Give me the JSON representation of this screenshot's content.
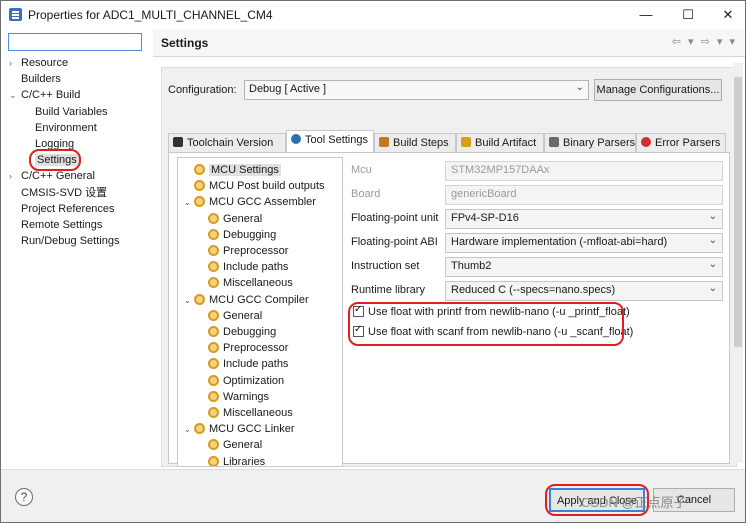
{
  "window": {
    "title": "Properties for ADC1_MULTI_CHANNEL_CM4",
    "minimize": "—",
    "maximize": "☐",
    "close": "✕"
  },
  "left_tree": {
    "filter_value": "",
    "items": [
      {
        "label": "Resource",
        "arrow": "›"
      },
      {
        "label": "Builders",
        "arrow": ""
      },
      {
        "label": "C/C++ Build",
        "arrow": "⌄"
      },
      {
        "label": "Build Variables",
        "arrow": ""
      },
      {
        "label": "Environment",
        "arrow": ""
      },
      {
        "label": "Logging",
        "arrow": ""
      },
      {
        "label": "Settings",
        "arrow": ""
      },
      {
        "label": "C/C++ General",
        "arrow": "›"
      },
      {
        "label": "CMSIS-SVD 设置",
        "arrow": ""
      },
      {
        "label": "Project References",
        "arrow": ""
      },
      {
        "label": "Remote Settings",
        "arrow": ""
      },
      {
        "label": "Run/Debug Settings",
        "arrow": ""
      }
    ]
  },
  "settings": {
    "title": "Settings",
    "nav_icons": "⇦ ▾ ⇨ ▾ ▾",
    "configuration_label": "Configuration:",
    "configuration_value": "Debug  [ Active ]",
    "manage_button": "Manage Configurations...",
    "tabs": [
      {
        "label": "Toolchain Version",
        "color": "#333333"
      },
      {
        "label": "Tool Settings",
        "color": "#2f6fb0"
      },
      {
        "label": "Build Steps",
        "color": "#c07a20"
      },
      {
        "label": "Build Artifact",
        "color": "#d4a017"
      },
      {
        "label": "Binary Parsers",
        "color": "#6a6a6a"
      },
      {
        "label": "Error Parsers",
        "color": "#d03030"
      }
    ]
  },
  "tool_tree": [
    {
      "label": "MCU Settings",
      "arrow": ""
    },
    {
      "label": "MCU Post build outputs",
      "arrow": ""
    },
    {
      "label": "MCU GCC Assembler",
      "arrow": "⌄"
    },
    {
      "label": "General",
      "arrow": ""
    },
    {
      "label": "Debugging",
      "arrow": ""
    },
    {
      "label": "Preprocessor",
      "arrow": ""
    },
    {
      "label": "Include paths",
      "arrow": ""
    },
    {
      "label": "Miscellaneous",
      "arrow": ""
    },
    {
      "label": "MCU GCC Compiler",
      "arrow": "⌄"
    },
    {
      "label": "General",
      "arrow": ""
    },
    {
      "label": "Debugging",
      "arrow": ""
    },
    {
      "label": "Preprocessor",
      "arrow": ""
    },
    {
      "label": "Include paths",
      "arrow": ""
    },
    {
      "label": "Optimization",
      "arrow": ""
    },
    {
      "label": "Warnings",
      "arrow": ""
    },
    {
      "label": "Miscellaneous",
      "arrow": ""
    },
    {
      "label": "MCU GCC Linker",
      "arrow": "⌄"
    },
    {
      "label": "General",
      "arrow": ""
    },
    {
      "label": "Libraries",
      "arrow": ""
    }
  ],
  "form": {
    "mcu_label": "Mcu",
    "mcu_value": "STM32MP157DAAx",
    "board_label": "Board",
    "board_value": "genericBoard",
    "fpu_label": "Floating-point unit",
    "fpu_value": "FPv4-SP-D16",
    "abi_label": "Floating-point ABI",
    "abi_value": "Hardware implementation (-mfloat-abi=hard)",
    "iset_label": "Instruction set",
    "iset_value": "Thumb2",
    "runtime_label": "Runtime library",
    "runtime_value": "Reduced C (--specs=nano.specs)",
    "printf_float": "Use float with printf from newlib-nano (-u _printf_float)",
    "scanf_float": "Use float with scanf from newlib-nano (-u _scanf_float)"
  },
  "bottom": {
    "help": "?",
    "apply_close": "Apply and Close",
    "cancel": "Cancel",
    "watermark": "CSDN @正点原子"
  },
  "colors": {
    "highlight_red": "#e02020",
    "default_button_blue": "#3b7fd6"
  }
}
